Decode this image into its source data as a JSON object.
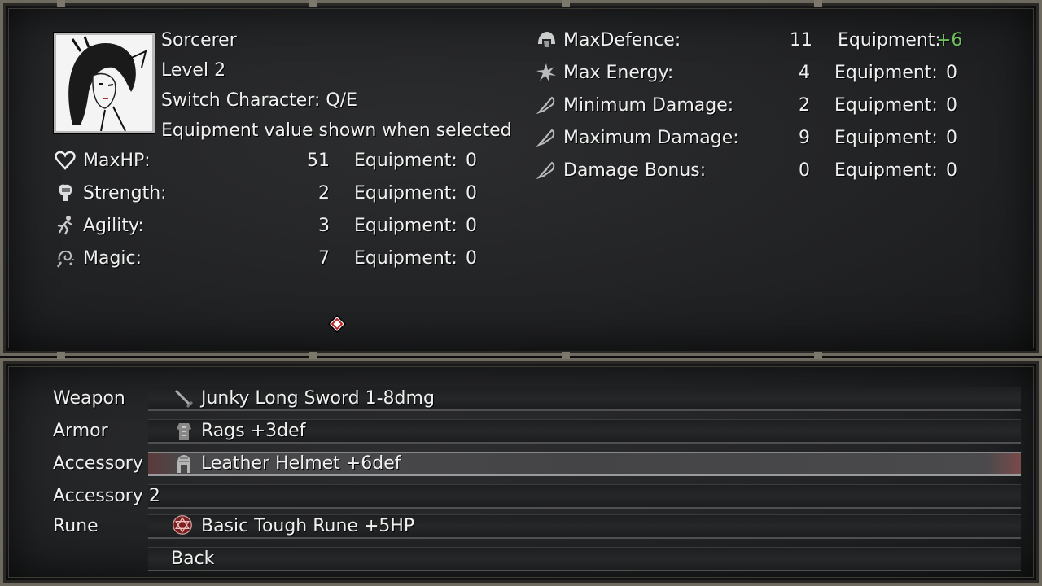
{
  "character": {
    "class_name": "Sorcerer",
    "level": "Level 2",
    "switch_hint": "Switch Character: Q/E",
    "equip_hint": "Equipment value shown when selected"
  },
  "left_stats": [
    {
      "label": "MaxHP:",
      "value": "51",
      "equip_label": "Equipment:",
      "equip_value": "0",
      "icon": "heart-icon"
    },
    {
      "label": "Strength:",
      "value": "2",
      "equip_label": "Equipment:",
      "equip_value": "0",
      "icon": "fist-icon"
    },
    {
      "label": "Agility:",
      "value": "3",
      "equip_label": "Equipment:",
      "equip_value": "0",
      "icon": "running-figure-icon"
    },
    {
      "label": "Magic:",
      "value": "7",
      "equip_label": "Equipment:",
      "equip_value": "0",
      "icon": "magic-swirl-icon"
    }
  ],
  "right_stats": [
    {
      "label": "MaxDefence:",
      "value": "11",
      "equip_label": "Equipment:",
      "equip_value": "+6",
      "icon": "helmet-icon"
    },
    {
      "label": "Max Energy:",
      "value": "4",
      "equip_label": "Equipment:",
      "equip_value": "0",
      "icon": "energy-burst-icon"
    },
    {
      "label": "Minimum Damage:",
      "value": "2",
      "equip_label": "Equipment:",
      "equip_value": "0",
      "icon": "feather-icon"
    },
    {
      "label": "Maximum Damage:",
      "value": "9",
      "equip_label": "Equipment:",
      "equip_value": "0",
      "icon": "feather-icon"
    },
    {
      "label": "Damage Bonus:",
      "value": "0",
      "equip_label": "Equipment:",
      "equip_value": "0",
      "icon": "feather-icon"
    }
  ],
  "slots": [
    {
      "label": "Weapon",
      "item": "Junky Long Sword 1-8dmg",
      "icon": "sword-icon",
      "selected": false
    },
    {
      "label": "Armor",
      "item": "Rags +3def",
      "icon": "rags-armor-icon",
      "selected": false
    },
    {
      "label": "Accessory",
      "item": "Leather Helmet +6def",
      "icon": "leather-helmet-icon",
      "selected": true
    },
    {
      "label": "Accessory 2",
      "item": "",
      "icon": "",
      "selected": false
    },
    {
      "label": "Rune",
      "item": "Basic Tough Rune +5HP",
      "icon": "red-rune-icon",
      "selected": false
    }
  ],
  "back_label": "Back",
  "colors": {
    "equip_bonus": "#6fbf5f",
    "selected_row": "#444446"
  }
}
